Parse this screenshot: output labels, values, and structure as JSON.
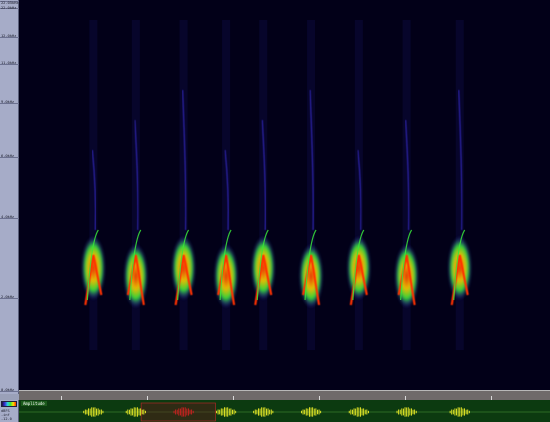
{
  "frequency_axis": {
    "ticks": [
      {
        "label": "22.05kHz"
      },
      {
        "label": "22.0kHz"
      },
      {
        "label": "12.0kHz"
      },
      {
        "label": "11.0kHz"
      },
      {
        "label": "9.0kHz"
      },
      {
        "label": "6.0kHz"
      },
      {
        "label": "4.0kHz"
      },
      {
        "label": "2.0kHz"
      },
      {
        "label": "0.0kHz"
      }
    ]
  },
  "waveform_panel": {
    "amplitude_label": "Amplitude",
    "scale_labels": [
      "dBFS",
      "-inf",
      "-12.0"
    ]
  },
  "colors": {
    "background": "#020018",
    "low_intensity": "#3a2dd8",
    "mid_intensity": "#38e838",
    "high_intensity": "#ff3000",
    "selection": "#d02020",
    "waveform": "#f0f028"
  },
  "selection": {
    "start_fraction": 0.23,
    "end_fraction": 0.37
  },
  "spectrogram": {
    "syllable_positions": [
      0.14,
      0.22,
      0.31,
      0.39,
      0.46,
      0.55,
      0.64,
      0.73,
      0.83
    ]
  }
}
